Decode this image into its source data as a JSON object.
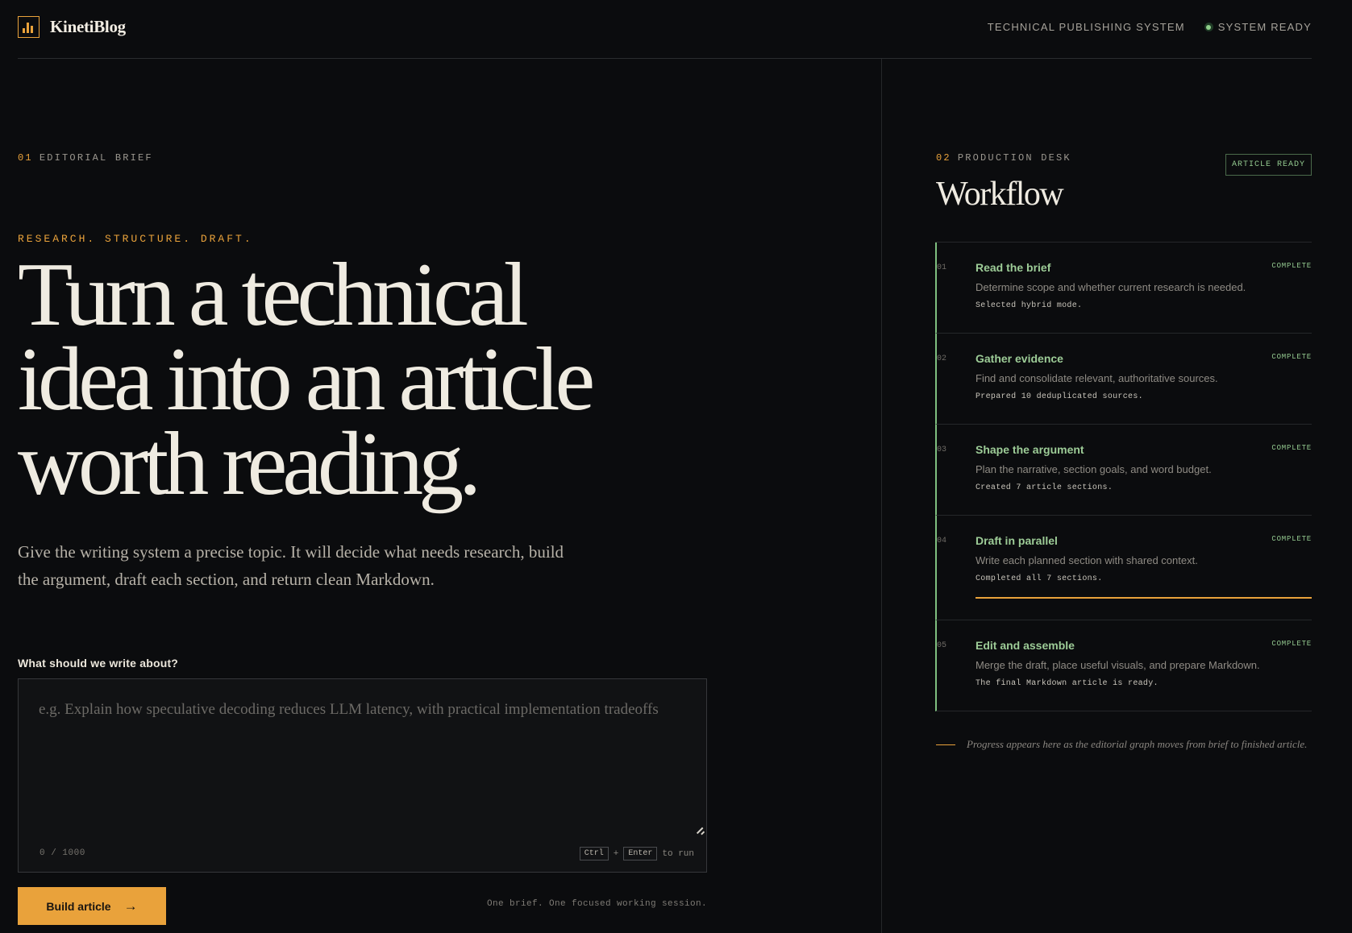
{
  "brand": {
    "name": "KinetiBlog",
    "logo_icon": "bar-chart-icon",
    "accent": "#e9a23b"
  },
  "header": {
    "system_label": "TECHNICAL PUBLISHING SYSTEM",
    "status": "SYSTEM READY",
    "status_color": "#8fcf8a"
  },
  "brief": {
    "section_num": "01",
    "section_label": "EDITORIAL BRIEF",
    "kicker": "RESEARCH. STRUCTURE. DRAFT.",
    "headline": [
      "Turn a technical",
      "idea into an article",
      "worth reading."
    ],
    "lede": "Give the writing system a precise topic. It will decide what needs research, build the argument, draft each section, and return clean Markdown.",
    "field_label": "What should we write about?",
    "placeholder": "e.g. Explain how speculative decoding reduces LLM latency, with practical implementation tradeoffs",
    "value": "",
    "counter": "0 / 1000",
    "hint": {
      "key1": "Ctrl",
      "plus": "+",
      "key2": "Enter",
      "suffix": "to run"
    },
    "build_label": "Build article",
    "footnote": "One brief. One focused working session."
  },
  "desk": {
    "section_num": "02",
    "section_label": "PRODUCTION DESK",
    "title": "Workflow",
    "badge": "ARTICLE READY",
    "steps": [
      {
        "idx": "01",
        "title": "Read the brief",
        "desc": "Determine scope and whether current research is needed.",
        "note": "Selected hybrid mode.",
        "state": "COMPLETE"
      },
      {
        "idx": "02",
        "title": "Gather evidence",
        "desc": "Find and consolidate relevant, authoritative sources.",
        "note": "Prepared 10 deduplicated sources.",
        "state": "COMPLETE"
      },
      {
        "idx": "03",
        "title": "Shape the argument",
        "desc": "Plan the narrative, section goals, and word budget.",
        "note": "Created 7 article sections.",
        "state": "COMPLETE"
      },
      {
        "idx": "04",
        "title": "Draft in parallel",
        "desc": "Write each planned section with shared context.",
        "note": "Completed all 7 sections.",
        "state": "COMPLETE",
        "progress": 1.0
      },
      {
        "idx": "05",
        "title": "Edit and assemble",
        "desc": "Merge the draft, place useful visuals, and prepare Markdown.",
        "note": "The final Markdown article is ready.",
        "state": "COMPLETE"
      }
    ],
    "progress_note": "Progress appears here as the editorial graph moves from brief to finished article."
  }
}
